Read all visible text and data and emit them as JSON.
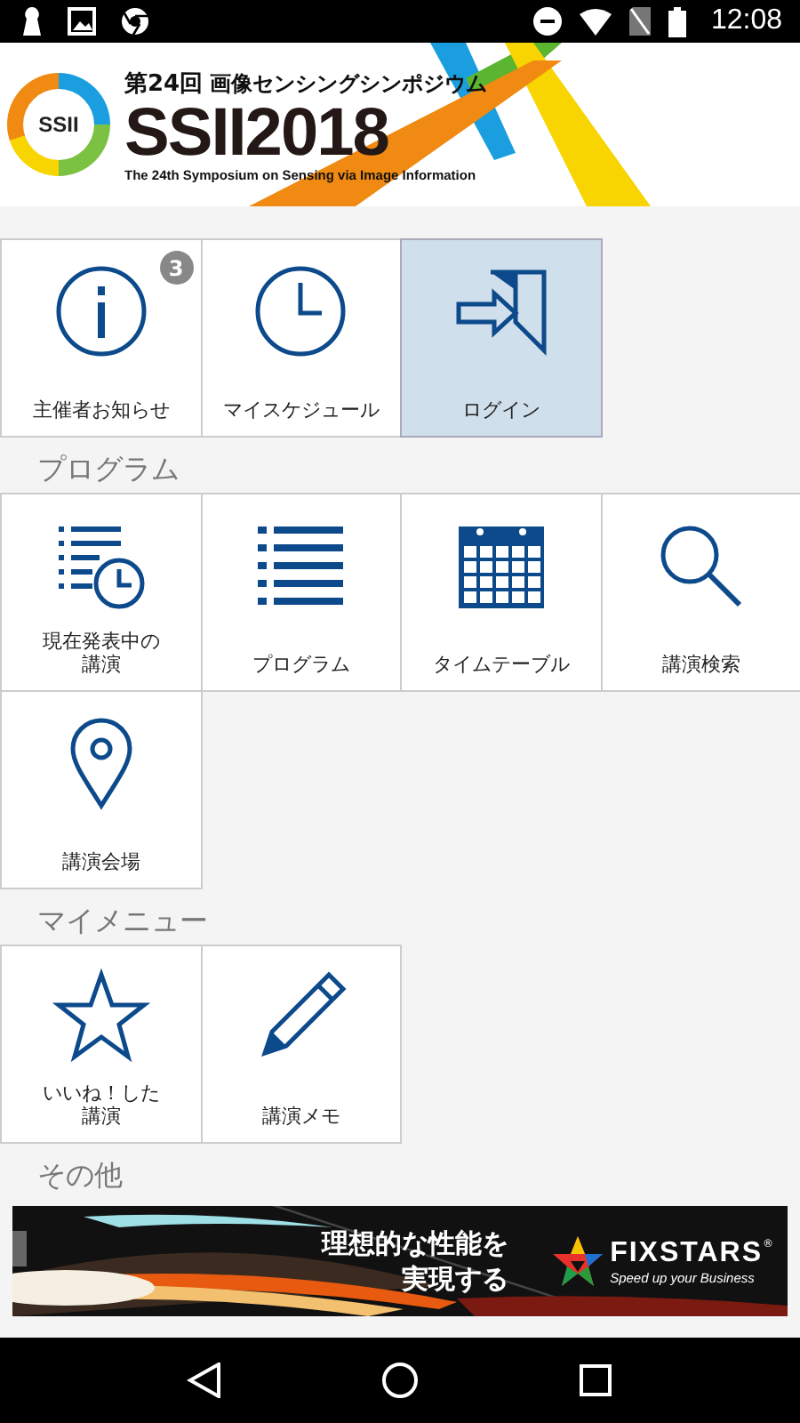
{
  "status_bar": {
    "time": "12:08"
  },
  "header": {
    "emblem": "SSII",
    "edition": "第24回",
    "title_jp": "画像センシングシンポジウム",
    "logo_title": "SSII2018",
    "subtitle": "The 24th Symposium on Sensing via Image Information"
  },
  "sections": [
    {
      "tiles": [
        {
          "kind": "info",
          "label_lines": [
            "主催者お知らせ"
          ],
          "badge": "3",
          "selected": false
        },
        {
          "kind": "clock",
          "label_lines": [
            "マイスケジュール"
          ],
          "selected": false
        },
        {
          "kind": "login",
          "label_lines": [
            "ログイン"
          ],
          "selected": true
        }
      ]
    },
    {
      "heading": "プログラム",
      "tiles": [
        {
          "kind": "now",
          "label_lines": [
            "現在発表中の",
            "講演"
          ],
          "selected": false
        },
        {
          "kind": "list",
          "label_lines": [
            "プログラム"
          ],
          "selected": false
        },
        {
          "kind": "calendar",
          "label_lines": [
            "タイムテーブル"
          ],
          "selected": false
        },
        {
          "kind": "search",
          "label_lines": [
            "講演検索"
          ],
          "selected": false
        },
        {
          "kind": "pin",
          "label_lines": [
            "講演会場"
          ],
          "selected": false
        }
      ]
    },
    {
      "heading": "マイメニュー",
      "tiles": [
        {
          "kind": "star",
          "label_lines": [
            "いいね！した",
            "講演"
          ],
          "selected": false
        },
        {
          "kind": "pencil",
          "label_lines": [
            "講演メモ"
          ],
          "selected": false
        }
      ]
    },
    {
      "heading": "その他"
    }
  ],
  "ad": {
    "headline_lines": [
      "理想的な性能を",
      "実現する"
    ],
    "brand": "FIXSTARS",
    "trademark": "®",
    "tagline": "Speed up your Business"
  }
}
